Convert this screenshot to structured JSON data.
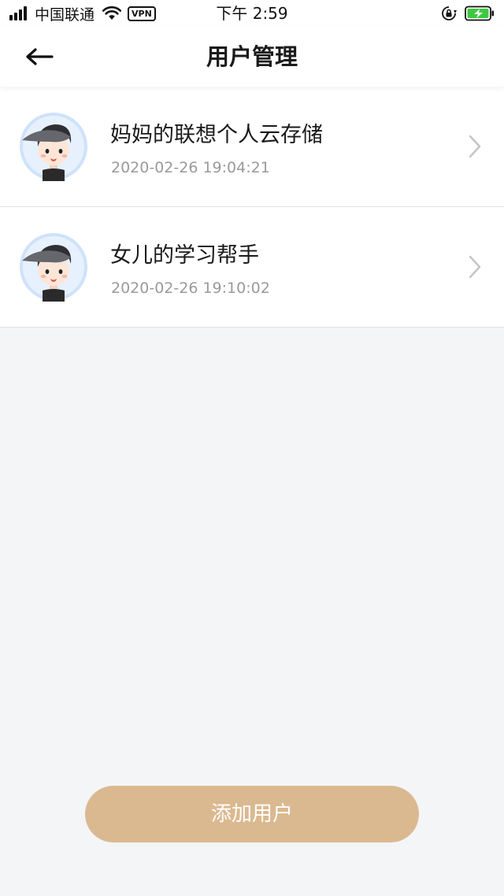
{
  "status_bar": {
    "carrier": "中国联通",
    "vpn_label": "VPN",
    "time": "下午 2:59",
    "icons": [
      "signal-icon",
      "wifi-icon",
      "vpn-icon",
      "orientation-lock-icon",
      "battery-charging-icon"
    ],
    "battery_color": "#3cc93f"
  },
  "header": {
    "title": "用户管理",
    "back_icon": "arrow-left-icon"
  },
  "users": [
    {
      "name": "妈妈的联想个人云存储",
      "created_at": "2020-02-26 19:04:21",
      "avatar": "boy-cap-avatar"
    },
    {
      "name": "女儿的学习帮手",
      "created_at": "2020-02-26 19:10:02",
      "avatar": "boy-cap-avatar"
    }
  ],
  "actions": {
    "add_user_label": "添加用户",
    "accent_color": "#dbb990"
  }
}
